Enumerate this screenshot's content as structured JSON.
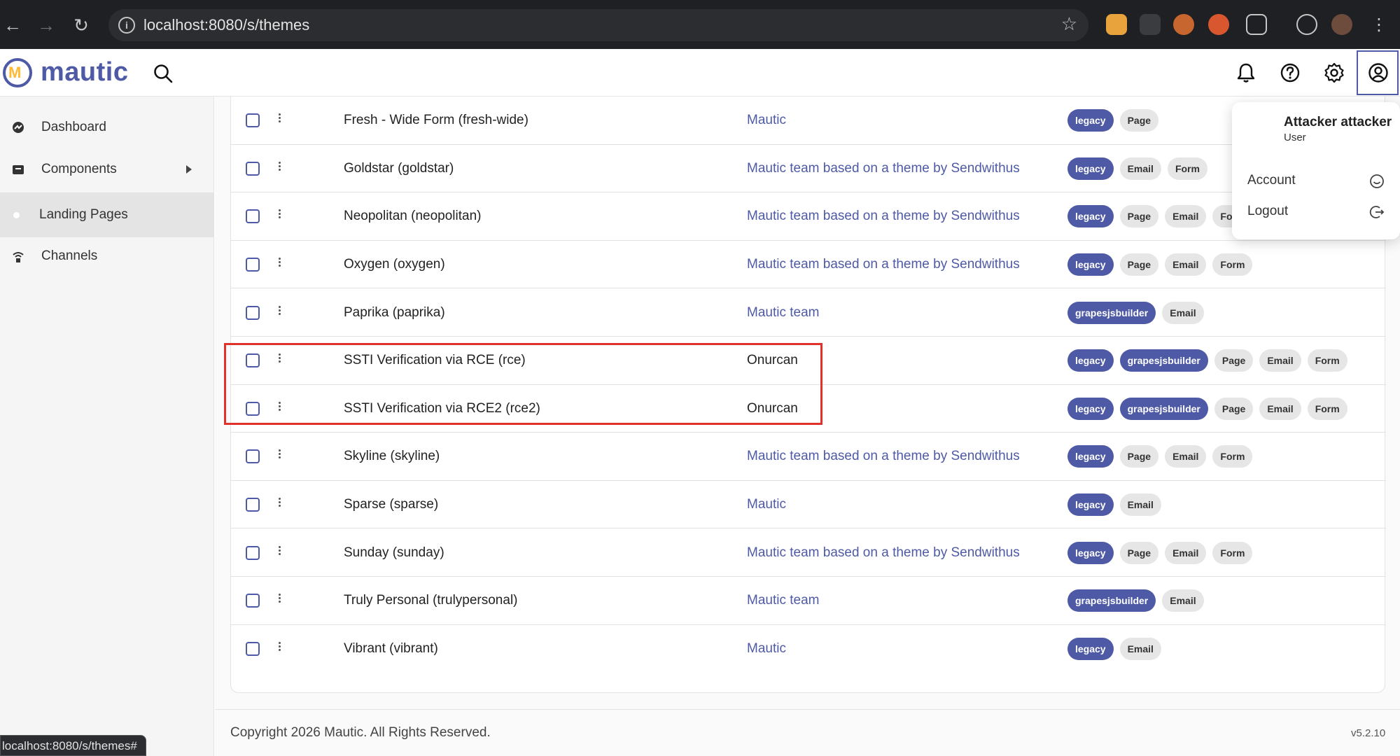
{
  "browser": {
    "url": "localhost:8080/s/themes",
    "status_url": "localhost:8080/s/themes#"
  },
  "header": {
    "logo_text": "mautic",
    "logo_mark": "M"
  },
  "sidebar": {
    "items": [
      {
        "label": "Dashboard",
        "icon": "dashboard-icon"
      },
      {
        "label": "Components",
        "icon": "components-icon"
      },
      {
        "label": "Landing Pages",
        "icon": "dot-icon"
      },
      {
        "label": "Channels",
        "icon": "channels-icon"
      }
    ]
  },
  "user_menu": {
    "name": "Attacker attacker",
    "role": "User",
    "account_label": "Account",
    "logout_label": "Logout"
  },
  "themes": {
    "rows": [
      {
        "name": "Fresh - Wide Form (fresh-wide)",
        "author": "Mautic",
        "author_link": true,
        "tags": [
          "legacy",
          "Page"
        ]
      },
      {
        "name": "Goldstar (goldstar)",
        "author": "Mautic team based on a theme by Sendwithus",
        "author_link": true,
        "tags": [
          "legacy",
          "Email",
          "Form"
        ]
      },
      {
        "name": "Neopolitan (neopolitan)",
        "author": "Mautic team based on a theme by Sendwithus",
        "author_link": true,
        "tags": [
          "legacy",
          "Page",
          "Email",
          "Form"
        ]
      },
      {
        "name": "Oxygen (oxygen)",
        "author": "Mautic team based on a theme by Sendwithus",
        "author_link": true,
        "tags": [
          "legacy",
          "Page",
          "Email",
          "Form"
        ]
      },
      {
        "name": "Paprika (paprika)",
        "author": "Mautic team",
        "author_link": true,
        "tags": [
          "grapesjsbuilder",
          "Email"
        ]
      },
      {
        "name": "SSTI Verification via RCE (rce)",
        "author": "Onurcan",
        "author_link": false,
        "tags": [
          "legacy",
          "grapesjsbuilder",
          "Page",
          "Email",
          "Form"
        ]
      },
      {
        "name": "SSTI Verification via RCE2 (rce2)",
        "author": "Onurcan",
        "author_link": false,
        "tags": [
          "legacy",
          "grapesjsbuilder",
          "Page",
          "Email",
          "Form"
        ]
      },
      {
        "name": "Skyline (skyline)",
        "author": "Mautic team based on a theme by Sendwithus",
        "author_link": true,
        "tags": [
          "legacy",
          "Page",
          "Email",
          "Form"
        ]
      },
      {
        "name": "Sparse (sparse)",
        "author": "Mautic",
        "author_link": true,
        "tags": [
          "legacy",
          "Email"
        ]
      },
      {
        "name": "Sunday (sunday)",
        "author": "Mautic team based on a theme by Sendwithus",
        "author_link": true,
        "tags": [
          "legacy",
          "Page",
          "Email",
          "Form"
        ]
      },
      {
        "name": "Truly Personal (trulypersonal)",
        "author": "Mautic team",
        "author_link": true,
        "tags": [
          "grapesjsbuilder",
          "Email"
        ]
      },
      {
        "name": "Vibrant (vibrant)",
        "author": "Mautic",
        "author_link": true,
        "tags": [
          "legacy",
          "Email"
        ]
      }
    ]
  },
  "footer": {
    "copyright": "Copyright 2026 Mautic. All Rights Reserved.",
    "version": "v5.2.10"
  },
  "colors": {
    "brand": "#4e5aa5",
    "brand_accent": "#fdb933",
    "highlight": "#e0312b"
  }
}
